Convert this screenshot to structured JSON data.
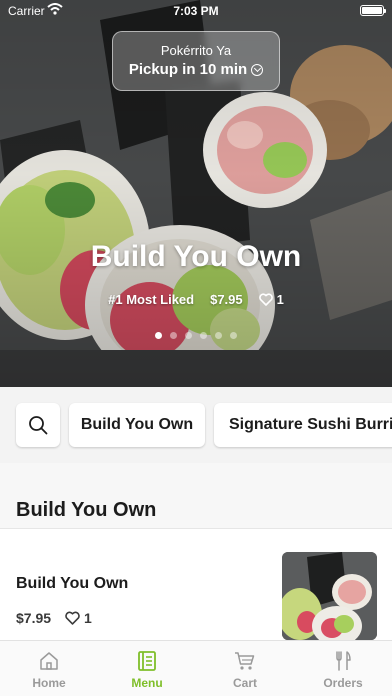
{
  "status_bar": {
    "carrier": "Carrier",
    "time": "7:03 PM"
  },
  "pickup": {
    "store": "Pokérrito Ya",
    "when": "Pickup in 10 min"
  },
  "hero": {
    "title": "Build You Own",
    "tag": "#1 Most Liked",
    "price": "$7.95",
    "likes": "1",
    "slides_total": 6,
    "active_slide": 1
  },
  "categories": {
    "items": [
      "Build You Own",
      "Signature Sushi Burrito"
    ]
  },
  "section": {
    "title": "Build You Own"
  },
  "menu_item": {
    "name": "Build You Own",
    "price": "$7.95",
    "likes": "1"
  },
  "tabs": [
    {
      "label": "Home",
      "icon": "home-icon"
    },
    {
      "label": "Menu",
      "icon": "menu-icon"
    },
    {
      "label": "Cart",
      "icon": "cart-icon"
    },
    {
      "label": "Orders",
      "icon": "fork-knife-icon"
    }
  ],
  "colors": {
    "accent": "#7fbf2a",
    "inactive": "#9a9a9a"
  }
}
